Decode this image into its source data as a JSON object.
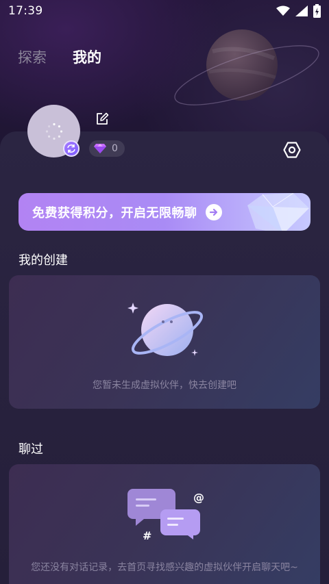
{
  "status_bar": {
    "time": "17:39"
  },
  "tabs": [
    {
      "label": "探索",
      "active": false
    },
    {
      "label": "我的",
      "active": true
    }
  ],
  "profile": {
    "points": "0"
  },
  "banner": {
    "text": "免费获得积分，开启无限畅聊"
  },
  "my_creations": {
    "title": "我的创建",
    "empty_text": "您暂未生成虚拟伙伴，快去创建吧"
  },
  "chatted": {
    "title": "聊过",
    "empty_text": "您还没有对话记录，去首页寻找感兴趣的虚拟伙伴开启聊天吧~"
  },
  "icons": {
    "wifi": "wifi-icon",
    "signal": "signal-icon",
    "battery": "battery-charging-icon",
    "edit": "edit-icon",
    "refresh": "refresh-icon",
    "gem": "gem-icon",
    "settings": "settings-icon",
    "arrow": "arrow-right-icon"
  },
  "colors": {
    "background": "#1d1731",
    "sheet": "#2b2542",
    "banner_start": "#b283f3",
    "banner_end": "#c7c9ff",
    "tab_inactive": "#8b8599",
    "caption": "#8a84a0"
  }
}
